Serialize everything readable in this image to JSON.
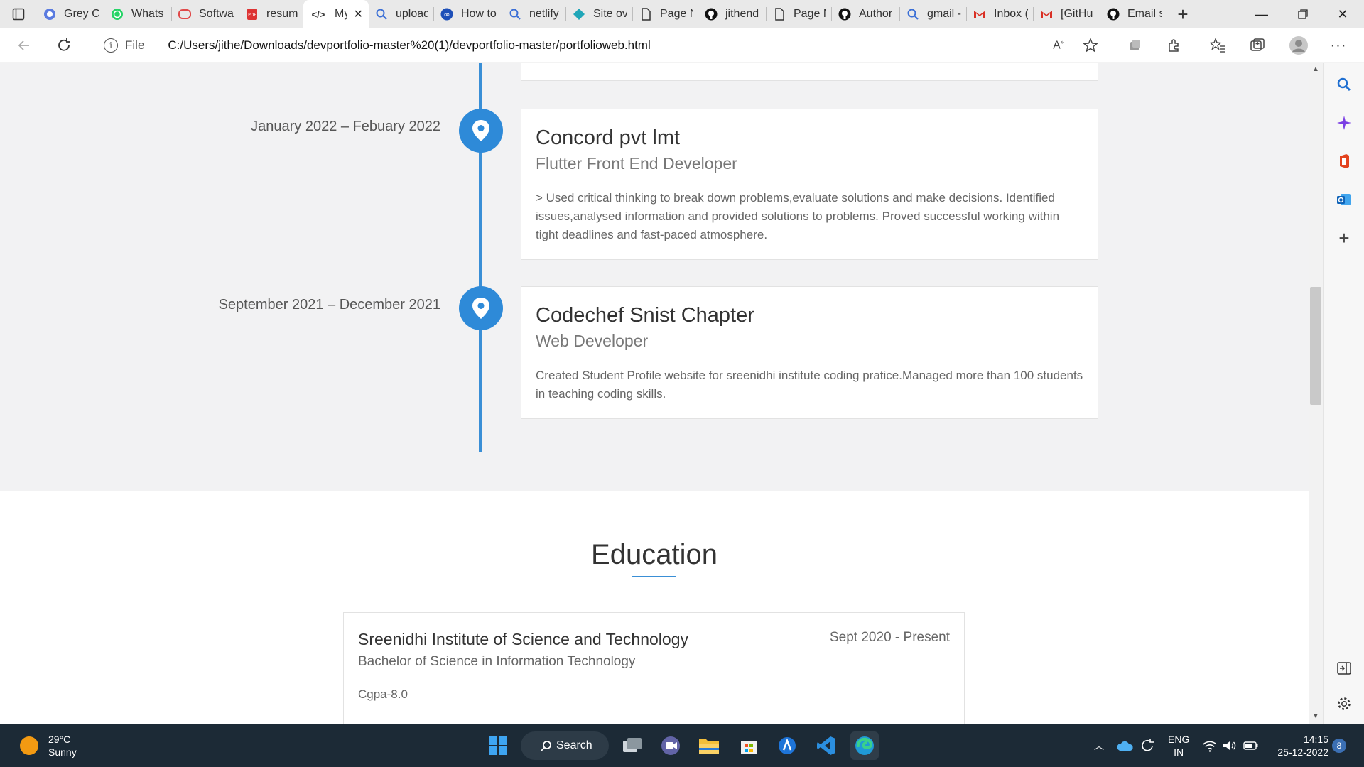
{
  "browser": {
    "tabs": [
      {
        "title": "Grey Cl",
        "icon": "grey-circle-icon"
      },
      {
        "title": "Whats",
        "icon": "whatsapp-icon"
      },
      {
        "title": "Softwa",
        "icon": "software-icon"
      },
      {
        "title": "resume",
        "icon": "pdf-icon"
      },
      {
        "title": "My",
        "icon": "code-icon"
      },
      {
        "title": "upload",
        "icon": "search-icon"
      },
      {
        "title": "How to",
        "icon": "infinity-icon"
      },
      {
        "title": "netlify",
        "icon": "search-icon"
      },
      {
        "title": "Site ov",
        "icon": "netlify-icon"
      },
      {
        "title": "Page N",
        "icon": "page-icon"
      },
      {
        "title": "jithend",
        "icon": "github-icon"
      },
      {
        "title": "Page N",
        "icon": "page-icon"
      },
      {
        "title": "Author",
        "icon": "github-icon"
      },
      {
        "title": "gmail -",
        "icon": "search-icon"
      },
      {
        "title": "Inbox (",
        "icon": "gmail-icon"
      },
      {
        "title": "[GitHu",
        "icon": "gmail-icon"
      },
      {
        "title": "Email s",
        "icon": "github-icon"
      }
    ],
    "active_tab_icon_text": "</>",
    "address": {
      "scheme_label": "File",
      "url": "C:/Users/jithe/Downloads/devportfolio-master%20(1)/devportfolio-master/portfolioweb.html"
    }
  },
  "experience": [
    {
      "date": "January 2022 – Febuary 2022",
      "company": "Concord pvt lmt",
      "role": "Flutter Front End Developer",
      "description": "> Used critical thinking to break down problems,evaluate solutions and make decisions. Identified issues,analysed information and provided solutions to problems. Proved successful working within tight deadlines and fast-paced atmosphere."
    },
    {
      "date": "September 2021 – December 2021",
      "company": "Codechef Snist Chapter",
      "role": "Web Developer",
      "description": "Created Student Profile website for sreenidhi institute coding pratice.Managed more than 100 students in teaching coding skills."
    }
  ],
  "education": {
    "heading": "Education",
    "items": [
      {
        "school": "Sreenidhi Institute of Science and Technology",
        "date": "Sept 2020 - Present",
        "degree": "Bachelor of Science in Information Technology",
        "grade": "Cgpa-8.0"
      }
    ]
  },
  "taskbar": {
    "weather_temp": "29°C",
    "weather_desc": "Sunny",
    "search_label": "Search",
    "lang_top": "ENG",
    "lang_bottom": "IN",
    "time": "14:15",
    "date": "25-12-2022",
    "notification_count": "8"
  },
  "colors": {
    "accent": "#2e8ad8",
    "taskbar": "#1c2a36"
  }
}
